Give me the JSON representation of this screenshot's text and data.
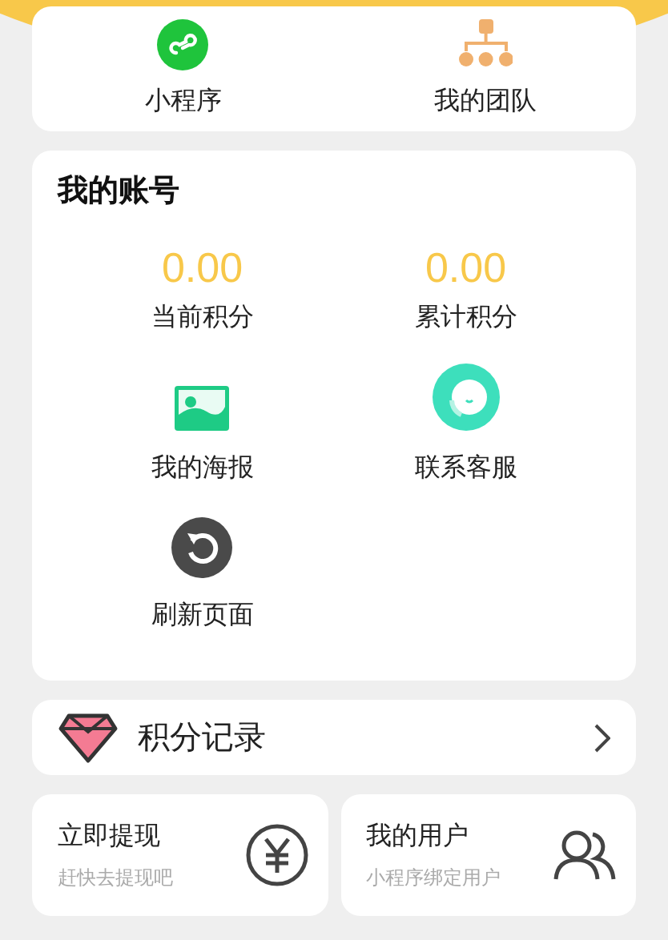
{
  "shortcuts": [
    {
      "label": "小程序"
    },
    {
      "label": "我的团队"
    }
  ],
  "account": {
    "title": "我的账号",
    "items": [
      {
        "kind": "stat",
        "value": "0.00",
        "label": "当前积分"
      },
      {
        "kind": "stat",
        "value": "0.00",
        "label": "累计积分"
      },
      {
        "kind": "action",
        "label": "我的海报"
      },
      {
        "kind": "action",
        "label": "联系客服"
      },
      {
        "kind": "action",
        "label": "刷新页面"
      }
    ]
  },
  "points_record": {
    "label": "积分记录"
  },
  "tiles": [
    {
      "title": "立即提现",
      "subtitle": "赶快去提现吧"
    },
    {
      "title": "我的用户",
      "subtitle": "小程序绑定用户"
    }
  ]
}
